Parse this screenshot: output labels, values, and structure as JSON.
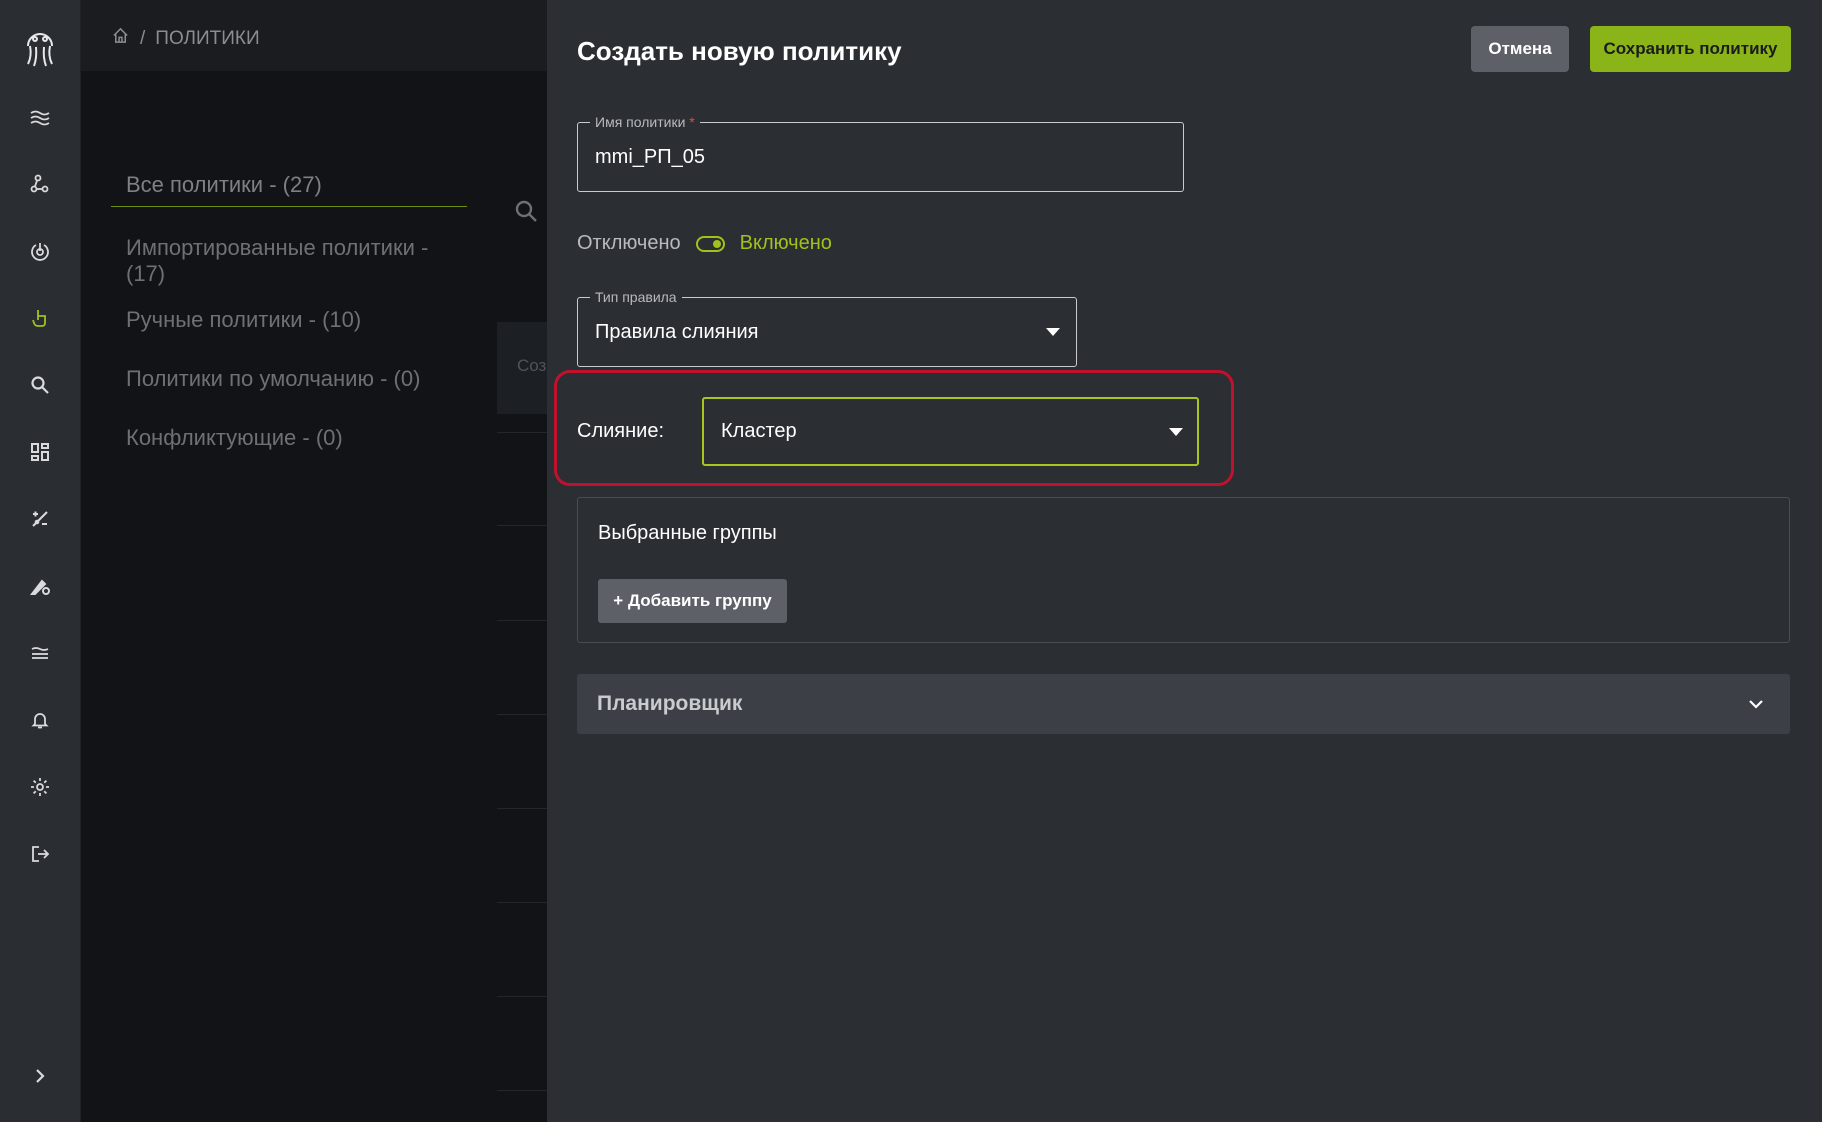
{
  "breadcrumb": {
    "separator": "/",
    "current": "ПОЛИТИКИ"
  },
  "policy_nav": [
    {
      "label": "Все политики - (27)"
    },
    {
      "label": "Импортированные политики - (17)"
    },
    {
      "label": "Ручные политики - (10)"
    },
    {
      "label": "Политики по умолчанию - (0)"
    },
    {
      "label": "Конфликтующие - (0)"
    }
  ],
  "background": {
    "partial_button_text": "Соз"
  },
  "sidebar": {
    "icons": [
      "logo-icon",
      "waves-icon",
      "nodes-icon",
      "power-icon",
      "touch-icon",
      "search-icon",
      "dashboard-icon",
      "tools-icon",
      "edit-settings-icon",
      "layers-icon",
      "bell-icon",
      "gear-icon",
      "logout-icon",
      "expand-icon"
    ],
    "active": "touch-icon"
  },
  "drawer": {
    "title": "Создать новую политику",
    "cancel_label": "Отмена",
    "save_label": "Сохранить политику",
    "policy_name": {
      "label": "Имя политики",
      "required_mark": "*",
      "value": "mmi_РП_05"
    },
    "toggle": {
      "off_label": "Отключено",
      "on_label": "Включено",
      "state": "on"
    },
    "rule_type": {
      "label": "Тип правила",
      "value": "Правила слияния"
    },
    "merge": {
      "label": "Слияние:",
      "value": "Кластер"
    },
    "groups": {
      "title": "Выбранные группы",
      "add_label": "+ Добавить группу"
    },
    "scheduler": {
      "title": "Планировщик"
    }
  },
  "colors": {
    "accent": "#9fc31b",
    "save_button": "#8ab418",
    "highlight": "#c0112e",
    "drawer_bg": "#2b2e33"
  }
}
